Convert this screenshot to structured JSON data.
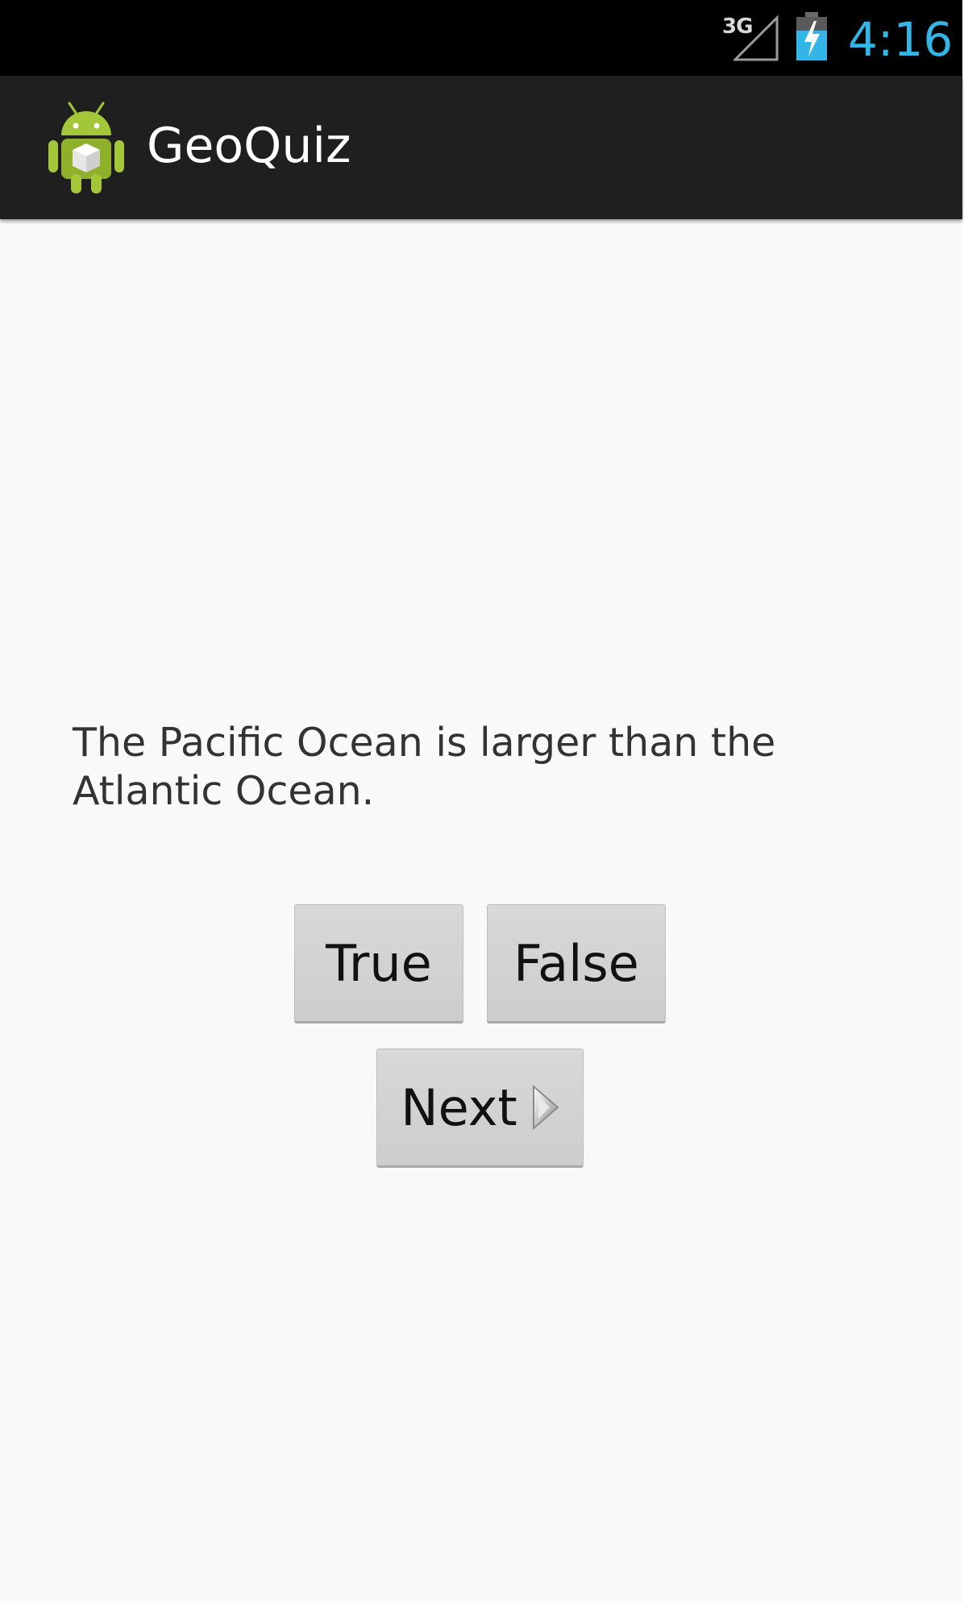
{
  "status_bar": {
    "network_label": "3G",
    "time": "4:16",
    "time_color": "#33b5e5",
    "icons": [
      "signal-icon",
      "battery-charging-icon"
    ]
  },
  "action_bar": {
    "title": "GeoQuiz",
    "icon": "android-app-icon",
    "background": "#1f1f1f"
  },
  "main": {
    "background": "#f9f9f9",
    "question": "The Pacific Ocean is larger than the Atlantic Ocean.",
    "buttons": {
      "true_label": "True",
      "false_label": "False",
      "next_label": "Next",
      "next_icon": "arrow-right-icon"
    }
  }
}
